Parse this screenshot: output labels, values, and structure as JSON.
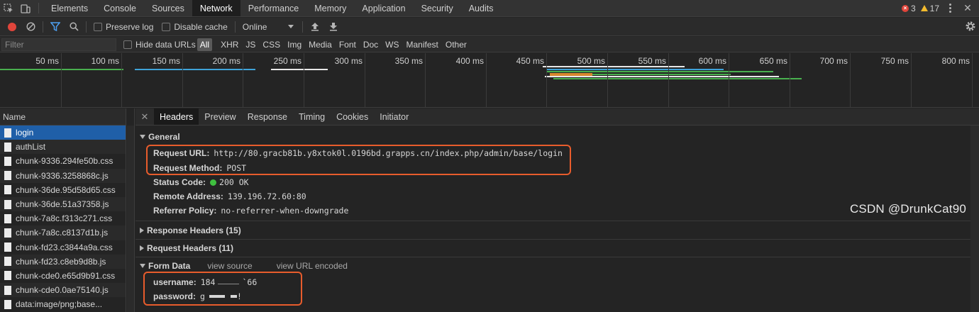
{
  "top_tabs": [
    "Elements",
    "Console",
    "Sources",
    "Network",
    "Performance",
    "Memory",
    "Application",
    "Security",
    "Audits"
  ],
  "active_tab": "Network",
  "counts": {
    "errors": "3",
    "warnings": "17"
  },
  "toolbar": {
    "preserve_log": "Preserve log",
    "disable_cache": "Disable cache",
    "throttling": "Online"
  },
  "filter": {
    "placeholder": "Filter",
    "hide_data_urls": "Hide data URLs",
    "types": [
      "All",
      "XHR",
      "JS",
      "CSS",
      "Img",
      "Media",
      "Font",
      "Doc",
      "WS",
      "Manifest",
      "Other"
    ],
    "active_type": "All"
  },
  "overview": {
    "tick_labels": [
      "50 ms",
      "100 ms",
      "150 ms",
      "200 ms",
      "250 ms",
      "300 ms",
      "350 ms",
      "400 ms",
      "450 ms",
      "500 ms",
      "550 ms",
      "600 ms",
      "650 ms",
      "700 ms",
      "750 ms",
      "800 ms"
    ]
  },
  "requests": {
    "header": "Name",
    "items": [
      "login",
      "authList",
      "chunk-9336.294fe50b.css",
      "chunk-9336.3258868c.js",
      "chunk-36de.95d58d65.css",
      "chunk-36de.51a37358.js",
      "chunk-7a8c.f313c271.css",
      "chunk-7a8c.c8137d1b.js",
      "chunk-fd23.c3844a9a.css",
      "chunk-fd23.c8eb9d8b.js",
      "chunk-cde0.e65d9b91.css",
      "chunk-cde0.0ae75140.js",
      "data:image/png;base..."
    ],
    "selected": "login"
  },
  "detail_tabs": [
    "Headers",
    "Preview",
    "Response",
    "Timing",
    "Cookies",
    "Initiator"
  ],
  "active_detail_tab": "Headers",
  "general": {
    "title": "General",
    "request_url_label": "Request URL:",
    "request_url": "http://80.gracb81b.y8xtok0l.0196bd.grapps.cn/index.php/admin/base/login",
    "request_method_label": "Request Method:",
    "request_method": "POST",
    "status_code_label": "Status Code:",
    "status_code": "200 OK",
    "remote_address_label": "Remote Address:",
    "remote_address": "139.196.72.60:80",
    "referrer_policy_label": "Referrer Policy:",
    "referrer_policy": "no-referrer-when-downgrade"
  },
  "response_headers": "Response Headers (15)",
  "request_headers": "Request Headers (11)",
  "form_data": {
    "title": "Form Data",
    "view_source": "view source",
    "view_url_encoded": "view URL encoded",
    "username_label": "username:",
    "username_start": "184",
    "username_end": "`66",
    "password_label": "password:",
    "password_start": "g",
    "password_end": "!"
  },
  "watermark": "CSDN @DrunkCat90",
  "colors": {
    "accent_blue": "#1f5fa8",
    "highlight_box": "#e85c2c",
    "status_green": "#3fbf3f"
  }
}
